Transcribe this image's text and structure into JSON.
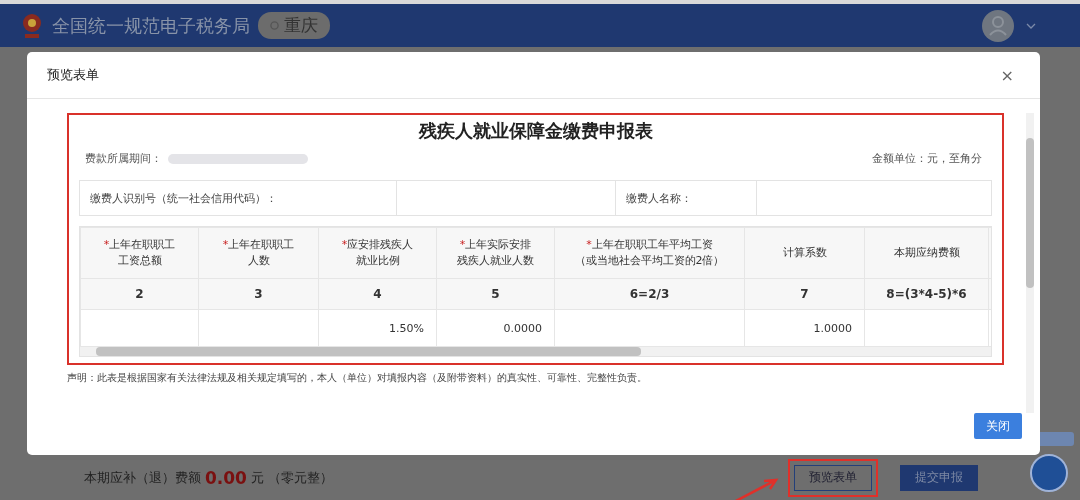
{
  "header": {
    "title": "全国统一规范电子税务局",
    "region": "重庆"
  },
  "dialog": {
    "title": "预览表单",
    "close": "×",
    "form": {
      "title": "残疾人就业保障金缴费申报表",
      "period_label": "费款所属期间：",
      "unit_note": "金额单位：元，至角分",
      "payer_id_label": "缴费人识别号（统一社会信用代码）：",
      "payer_name_label": "缴费人名称：",
      "columns": [
        {
          "mark": "*",
          "lines": [
            "上年在职职工",
            "工资总额"
          ]
        },
        {
          "mark": "*",
          "lines": [
            "上年在职职工",
            "人数"
          ]
        },
        {
          "mark": "*",
          "lines": [
            "应安排残疾人",
            "就业比例"
          ],
          "value": "1.50%"
        },
        {
          "mark": "*",
          "lines": [
            "上年实际安排",
            "残疾人就业人数"
          ],
          "value": "0.0000"
        },
        {
          "mark": "*",
          "lines": [
            "上年在职职工年平均工资",
            "（或当地社会平均工资的2倍）"
          ]
        },
        {
          "lines": [
            "计算系数"
          ],
          "value": "1.0000"
        },
        {
          "lines": [
            "本期应纳费额"
          ]
        }
      ],
      "column_numbers": [
        "2",
        "3",
        "4",
        "5",
        "6=2/3",
        "7",
        "8=(3*4-5)*6"
      ],
      "highlighted": true
    },
    "declaration": "声明：此表是根据国家有关法律法规及相关规定填写的，本人（单位）对填报内容（及附带资料）的真实性、可靠性、完整性负责。",
    "close_button": "关闭"
  },
  "footer": {
    "amount_label": "本期应补（退）费额",
    "amount": "0.00",
    "unit": "元",
    "amount_words": "（零元整）",
    "buttons": [
      {
        "label": "预览表单",
        "kind": "outline",
        "highlighted": true
      },
      {
        "label": "提交申报",
        "kind": "primary",
        "highlighted": false
      }
    ]
  }
}
